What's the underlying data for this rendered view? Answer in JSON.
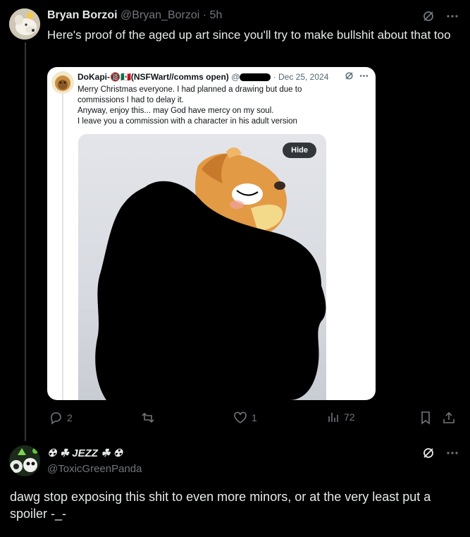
{
  "tweet1": {
    "name": "Bryan Borzoi",
    "handle": "@Bryan_Borzoi",
    "time": "· 5h",
    "text": "Here's proof of the aged up art since you'll try to make bullshit about that too"
  },
  "quote": {
    "name": "DoKapi-🔞🇲🇽(NSFWart//comms open)",
    "handle": "@",
    "date": "· Dec 25, 2024",
    "text": "Merry Christmas everyone. I had planned a drawing but due to\ncommissions I had to delay it.\nAnyway, enjoy this... may God have mercy on my soul.\n I leave you a commission with a character in his adult version",
    "hide_label": "Hide"
  },
  "actions": {
    "replies": "2",
    "retweets": "",
    "likes": "1",
    "views": "72"
  },
  "tweet2": {
    "name": "☢ ☘ JEZZ ☘ ☢",
    "handle": "@ToxicGreenPanda",
    "text": "dawg stop exposing this shit to even more minors, or at the very least put a spoiler -_-"
  },
  "colors": {
    "background": "#000000",
    "text": "#e7e9ea",
    "muted": "#71767b",
    "divider": "#333639"
  },
  "icons": [
    "grok-icon",
    "more-icon",
    "reply-icon",
    "retweet-icon",
    "like-icon",
    "views-icon",
    "bookmark-icon",
    "share-icon"
  ]
}
